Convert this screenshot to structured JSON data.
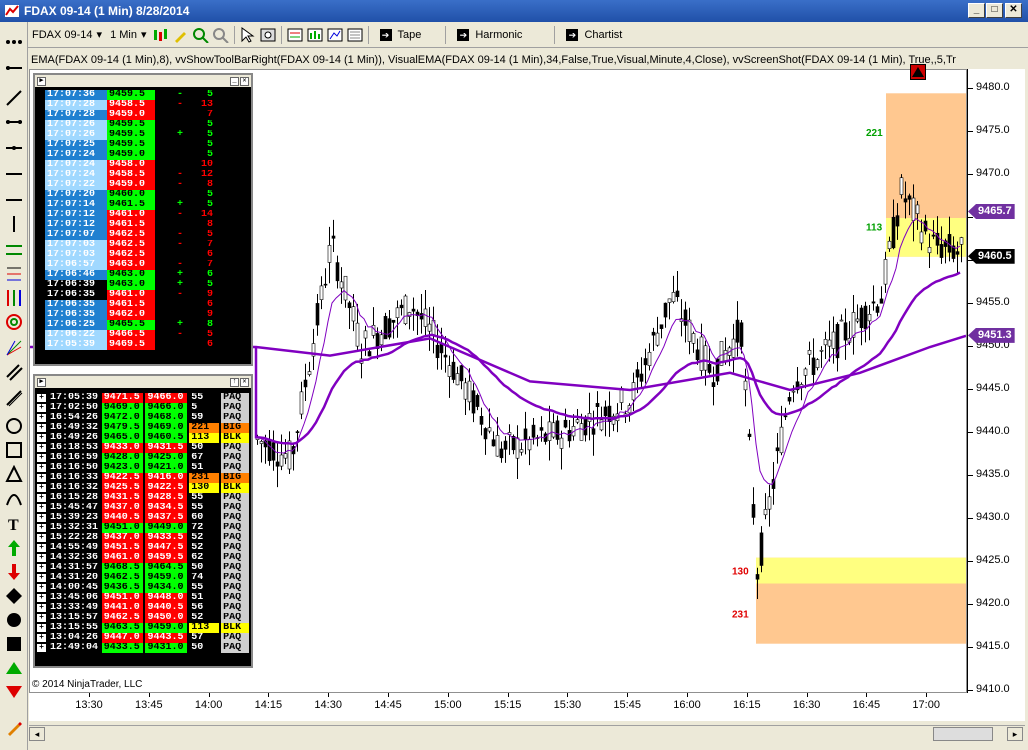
{
  "window": {
    "title": "FDAX 09-14 (1 Min)  8/28/2014"
  },
  "toolbar": {
    "instrument": "FDAX 09-14",
    "interval": "1 Min",
    "buttons": [
      "Tape",
      "Harmonic",
      "Chartist"
    ]
  },
  "indicator_line": "EMA(FDAX 09-14 (1 Min),8), vvShowToolBarRight(FDAX 09-14 (1 Min)), VisualEMA(FDAX 09-14 (1 Min),34,False,True,Visual,Minute,4,Close), vvScreenShot(FDAX 09-14 (1 Min), True,,5,Tr",
  "copyright": "© 2014 NinjaTrader, LLC",
  "colors": {
    "up": "#00ff00",
    "down": "#ff0000",
    "ema": "#8000c0",
    "zone_orange": "#ffc890",
    "zone_yellow": "#ffff80",
    "blue_light": "#a0d8ff",
    "blue_dark": "#2080d0"
  },
  "y_axis": {
    "ticks": [
      "9480.0",
      "9475.0",
      "9470.0",
      "9465.0",
      "9460.0",
      "9455.0",
      "9450.0",
      "9445.0",
      "9440.0",
      "9435.0",
      "9430.0",
      "9425.0",
      "9420.0",
      "9415.0",
      "9410.0"
    ],
    "tags": [
      {
        "value": "9465.7",
        "color": "#7030a0"
      },
      {
        "value": "9460.5",
        "color": "#000000"
      },
      {
        "value": "9451.3",
        "color": "#7030a0"
      }
    ]
  },
  "x_axis": {
    "ticks": [
      "13:30",
      "13:45",
      "14:00",
      "14:15",
      "14:30",
      "14:45",
      "15:00",
      "15:15",
      "15:30",
      "15:45",
      "16:00",
      "16:15",
      "16:30",
      "16:45",
      "17:00"
    ]
  },
  "zones": [
    {
      "label": "221",
      "color": "#00a000"
    },
    {
      "label": "113",
      "color": "#00a000"
    },
    {
      "label": "130",
      "color": "#e00000"
    },
    {
      "label": "231",
      "color": "#e00000"
    }
  ],
  "tape": [
    [
      "17:07:36",
      "9459.5",
      "-",
      "5",
      "d",
      "g"
    ],
    [
      "17:07:28",
      "9458.5",
      "-",
      "13",
      "l",
      "r"
    ],
    [
      "17:07:28",
      "9459.0",
      "",
      "7",
      "d",
      "r"
    ],
    [
      "17:07:26",
      "9459.5",
      "",
      "5",
      "l",
      "g"
    ],
    [
      "17:07:26",
      "9459.5",
      "+",
      "5",
      "l",
      "g"
    ],
    [
      "17:07:25",
      "9459.5",
      "",
      "5",
      "d",
      "g"
    ],
    [
      "17:07:24",
      "9459.0",
      "",
      "5",
      "d",
      "g"
    ],
    [
      "17:07:24",
      "9458.0",
      "",
      "10",
      "l",
      "r"
    ],
    [
      "17:07:24",
      "9458.5",
      "-",
      "12",
      "l",
      "r"
    ],
    [
      "17:07:22",
      "9459.0",
      "-",
      "8",
      "l",
      "r"
    ],
    [
      "17:07:20",
      "9460.0",
      "",
      "5",
      "d",
      "g"
    ],
    [
      "17:07:14",
      "9461.5",
      "+",
      "5",
      "d",
      "g"
    ],
    [
      "17:07:12",
      "9461.0",
      "-",
      "14",
      "d",
      "r"
    ],
    [
      "17:07:12",
      "9461.5",
      "",
      "8",
      "d",
      "r"
    ],
    [
      "17:07:07",
      "9462.5",
      "-",
      "5",
      "d",
      "r"
    ],
    [
      "17:07:03",
      "9462.5",
      "-",
      "7",
      "l",
      "r"
    ],
    [
      "17:07:03",
      "9462.5",
      "",
      "6",
      "l",
      "r"
    ],
    [
      "17:06:57",
      "9463.0",
      "-",
      "7",
      "l",
      "r"
    ],
    [
      "17:06:46",
      "9463.0",
      "+",
      "6",
      "d",
      "g"
    ],
    [
      "17:06:39",
      "9463.0",
      "+",
      "5",
      "k",
      "g"
    ],
    [
      "17:06:35",
      "9461.0",
      "-",
      "9",
      "k",
      "r"
    ],
    [
      "17:06:35",
      "9461.5",
      "",
      "6",
      "d",
      "r"
    ],
    [
      "17:06:35",
      "9462.0",
      "",
      "9",
      "d",
      "r"
    ],
    [
      "17:06:25",
      "9465.5",
      "+",
      "8",
      "d",
      "g"
    ],
    [
      "17:06:22",
      "9466.5",
      "-",
      "5",
      "l",
      "r"
    ],
    [
      "17:05:39",
      "9469.5",
      "",
      "6",
      "l",
      "r"
    ]
  ],
  "blocks": [
    [
      "17:05:39",
      "9471.5",
      "9466.0",
      "55",
      "PAQ",
      "r"
    ],
    [
      "17:02:50",
      "9469.0",
      "9466.0",
      "5",
      "PAQ",
      "g"
    ],
    [
      "16:54:26",
      "9472.0",
      "9468.0",
      "59",
      "PAQ",
      "g"
    ],
    [
      "16:49:32",
      "9479.5",
      "9469.0",
      "221",
      "BIG",
      "g"
    ],
    [
      "16:49:26",
      "9465.0",
      "9460.5",
      "113",
      "BLK",
      "g"
    ],
    [
      "16:18:53",
      "9433.0",
      "9431.5",
      "50",
      "PAQ",
      "r"
    ],
    [
      "16:16:59",
      "9428.0",
      "9425.0",
      "67",
      "PAQ",
      "g"
    ],
    [
      "16:16:50",
      "9423.0",
      "9421.0",
      "51",
      "PAQ",
      "g"
    ],
    [
      "16:16:33",
      "9422.5",
      "9416.0",
      "231",
      "BIG",
      "r"
    ],
    [
      "16:16:32",
      "9425.5",
      "9422.5",
      "130",
      "BLK",
      "r"
    ],
    [
      "16:15:28",
      "9431.5",
      "9428.5",
      "55",
      "PAQ",
      "r"
    ],
    [
      "15:45:47",
      "9437.0",
      "9434.5",
      "55",
      "PAQ",
      "r"
    ],
    [
      "15:39:23",
      "9440.5",
      "9437.5",
      "60",
      "PAQ",
      "r"
    ],
    [
      "15:32:31",
      "9451.0",
      "9449.0",
      "72",
      "PAQ",
      "g"
    ],
    [
      "15:22:28",
      "9437.0",
      "9433.5",
      "52",
      "PAQ",
      "r"
    ],
    [
      "14:55:49",
      "9451.5",
      "9447.5",
      "52",
      "PAQ",
      "r"
    ],
    [
      "14:32:36",
      "9461.0",
      "9459.5",
      "62",
      "PAQ",
      "r"
    ],
    [
      "14:31:57",
      "9468.5",
      "9464.5",
      "50",
      "PAQ",
      "g"
    ],
    [
      "14:31:20",
      "9462.5",
      "9459.0",
      "74",
      "PAQ",
      "g"
    ],
    [
      "14:00:45",
      "9436.5",
      "9434.0",
      "55",
      "PAQ",
      "g"
    ],
    [
      "13:45:06",
      "9451.0",
      "9448.0",
      "51",
      "PAQ",
      "r"
    ],
    [
      "13:33:49",
      "9441.0",
      "9440.5",
      "56",
      "PAQ",
      "r"
    ],
    [
      "13:15:57",
      "9462.5",
      "9450.0",
      "52",
      "PAQ",
      "r"
    ],
    [
      "13:15:55",
      "9463.5",
      "9459.0",
      "113",
      "BLK",
      "g"
    ],
    [
      "13:04:26",
      "9447.0",
      "9443.5",
      "57",
      "PAQ",
      "r"
    ],
    [
      "12:49:04",
      "9433.5",
      "9431.0",
      "50",
      "PAQ",
      "g"
    ]
  ]
}
